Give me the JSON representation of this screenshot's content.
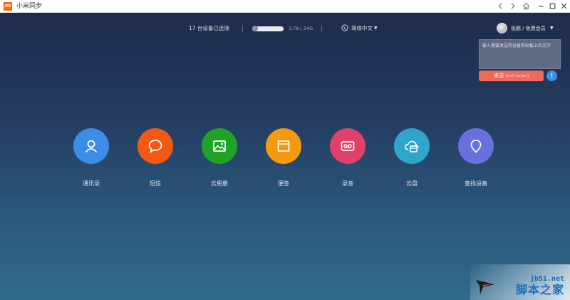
{
  "window": {
    "logo_text": "mi",
    "title": "小米同步"
  },
  "status": {
    "devices_text": "17 台设备已连接",
    "storage_text": "3.78 / 24G",
    "storage_fraction": 0.16,
    "language": "简体中文"
  },
  "user": {
    "name": "张鹏 / 免费会员"
  },
  "clipboard": {
    "placeholder": "输入需要发送到设备剪贴板上的文字",
    "send_label": "发送",
    "send_hint": "[ctrl+enter]",
    "info_symbol": "!"
  },
  "features": [
    {
      "label": "通讯录",
      "color": "#3a8ee6",
      "icon": "person-icon"
    },
    {
      "label": "短信",
      "color": "#f25a14",
      "icon": "chat-bubble-icon"
    },
    {
      "label": "云相册",
      "color": "#21a325",
      "icon": "image-icon"
    },
    {
      "label": "便签",
      "color": "#f49a0e",
      "icon": "note-icon"
    },
    {
      "label": "录音",
      "color": "#e0406a",
      "icon": "tape-icon"
    },
    {
      "label": "云盘",
      "color": "#2ea6c9",
      "icon": "cloud-icon"
    },
    {
      "label": "查找设备",
      "color": "#6a6fe0",
      "icon": "location-pin-icon"
    }
  ],
  "watermark": {
    "site": "jb51.net",
    "name": "脚本之家"
  }
}
